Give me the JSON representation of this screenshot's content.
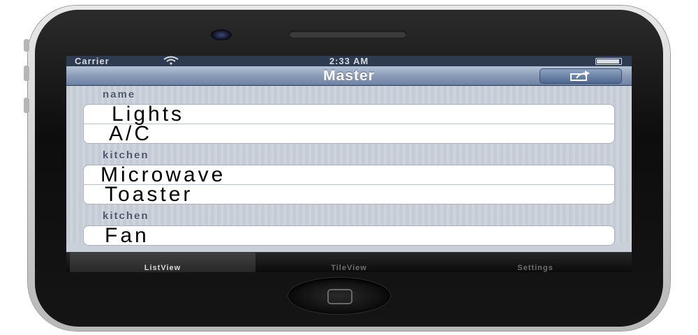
{
  "status_bar": {
    "carrier": "Carrier",
    "time": "2:33 AM"
  },
  "nav_bar": {
    "title": "Master",
    "action_icon": "share-icon"
  },
  "sections": [
    {
      "header": "name",
      "items": [
        "Lights",
        "A/C"
      ]
    },
    {
      "header": "kitchen",
      "items": [
        "Microwave",
        "Toaster"
      ]
    },
    {
      "header": "kitchen",
      "items": [
        "Fan"
      ]
    }
  ],
  "tabs": [
    {
      "label": "ListView",
      "selected": true
    },
    {
      "label": "TileView",
      "selected": false
    },
    {
      "label": "Settings",
      "selected": false
    }
  ],
  "colors": {
    "nav_bar": "#8a9cb8",
    "tab_bar": "#0a0a0a",
    "list_background": "#c9d0da"
  }
}
